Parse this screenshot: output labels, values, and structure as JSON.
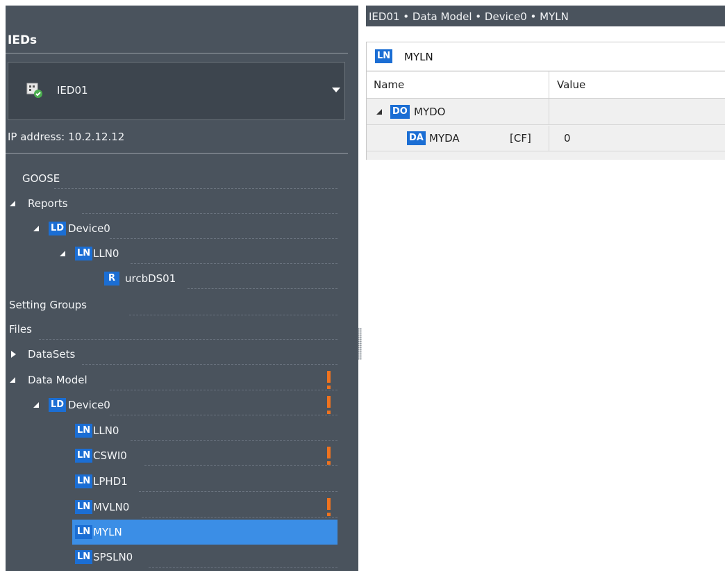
{
  "left_panel": {
    "title": "IEDs",
    "ied_selector": {
      "value": "IED01",
      "icon": "ied-device-icon"
    },
    "ip_label": "IP address:",
    "ip_value": "10.2.12.12",
    "tree": {
      "goose": "GOOSE",
      "reports": "Reports",
      "reports_ld": {
        "badge": "LD",
        "label": "Device0"
      },
      "reports_ln": {
        "badge": "LN",
        "label": "LLN0"
      },
      "reports_rcb": {
        "badge": "R",
        "label": "urcbDS01"
      },
      "setting_groups": "Setting Groups",
      "files": "Files",
      "datasets": "DataSets",
      "data_model": "Data Model",
      "dm_ld": {
        "badge": "LD",
        "label": "Device0"
      },
      "dm_lns": [
        {
          "badge": "LN",
          "label": "LLN0"
        },
        {
          "badge": "LN",
          "label": "CSWI0"
        },
        {
          "badge": "LN",
          "label": "LPHD1"
        },
        {
          "badge": "LN",
          "label": "MVLN0"
        },
        {
          "badge": "LN",
          "label": "MYLN"
        },
        {
          "badge": "LN",
          "label": "SPSLN0"
        }
      ]
    }
  },
  "breadcrumb": "IED01 • Data Model • Device0 • MYLN",
  "detail": {
    "badge": "LN",
    "title": "MYLN",
    "columns": {
      "name": "Name",
      "value": "Value"
    },
    "rows": [
      {
        "badge": "DO",
        "name": "MYDO",
        "fc": "",
        "value": ""
      },
      {
        "badge": "DA",
        "name": "MYDA",
        "fc": "[CF]",
        "value": "0"
      }
    ]
  },
  "colors": {
    "panel_bg": "#4a535d",
    "selection": "#3b8ee6",
    "badge": "#1b6ed4",
    "warning": "#f0731e"
  }
}
